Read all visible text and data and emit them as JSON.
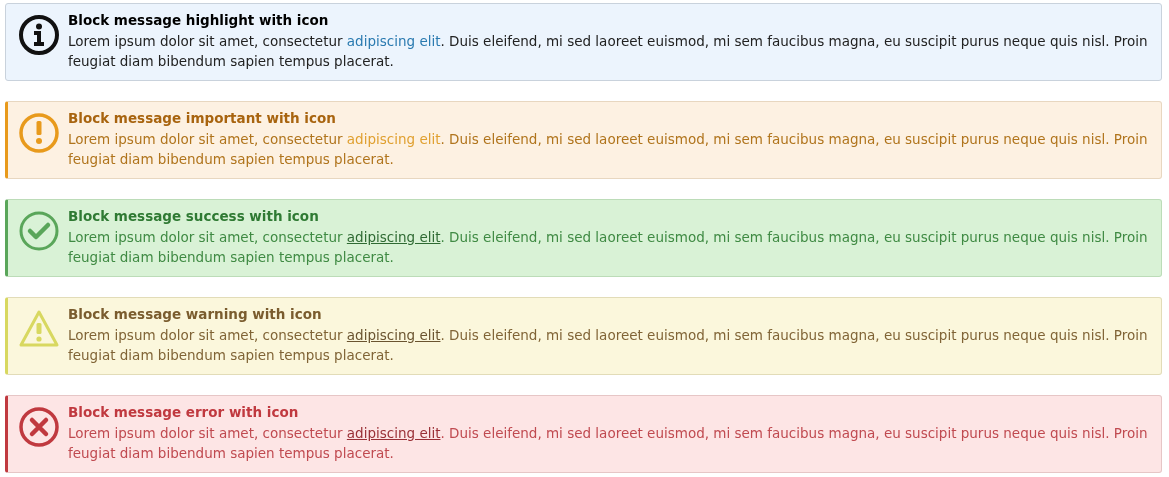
{
  "messages": [
    {
      "kind": "highlight",
      "title": "Block message highlight with icon",
      "text_before": "Lorem ipsum dolor sit amet, consectetur ",
      "link": "adipiscing elit",
      "text_after": ". Duis eleifend, mi sed laoreet euismod, mi sem faucibus magna, eu suscipit purus neque quis nisl. Proin feugiat diam bibendum sapien tempus placerat."
    },
    {
      "kind": "important",
      "title": "Block message important with icon",
      "text_before": "Lorem ipsum dolor sit amet, consectetur ",
      "link": "adipiscing elit",
      "text_after": ". Duis eleifend, mi sed laoreet euismod, mi sem faucibus magna, eu suscipit purus neque quis nisl. Proin feugiat diam bibendum sapien tempus placerat."
    },
    {
      "kind": "success",
      "title": "Block message success with icon",
      "text_before": "Lorem ipsum dolor sit amet, consectetur ",
      "link": "adipiscing elit",
      "text_after": ". Duis eleifend, mi sed laoreet euismod, mi sem faucibus magna, eu suscipit purus neque quis nisl. Proin feugiat diam bibendum sapien tempus placerat."
    },
    {
      "kind": "warning",
      "title": "Block message warning with icon",
      "text_before": "Lorem ipsum dolor sit amet, consectetur ",
      "link": "adipiscing elit",
      "text_after": ". Duis eleifend, mi sed laoreet euismod, mi sem faucibus magna, eu suscipit purus neque quis nisl. Proin feugiat diam bibendum sapien tempus placerat."
    },
    {
      "kind": "error",
      "title": "Block message error with icon",
      "text_before": "Lorem ipsum dolor sit amet, consectetur ",
      "link": "adipiscing elit",
      "text_after": ". Duis eleifend, mi sed laoreet euismod, mi sem faucibus magna, eu suscipit purus neque quis nisl. Proin feugiat diam bibendum sapien tempus placerat."
    }
  ]
}
